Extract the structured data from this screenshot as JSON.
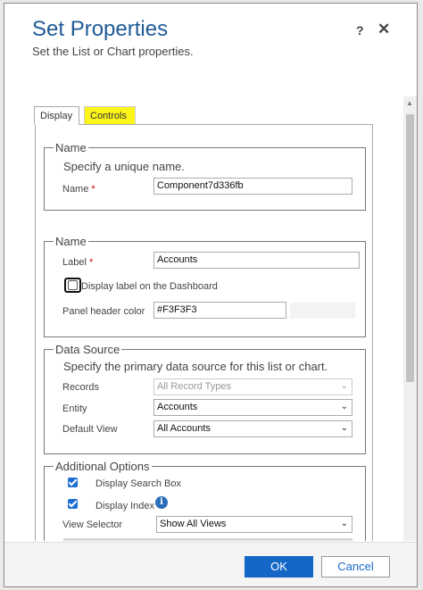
{
  "dialog": {
    "title": "Set Properties",
    "subtitle": "Set the List or Chart properties.",
    "help_icon": "?",
    "close_icon": "✕"
  },
  "tabs": [
    {
      "label": "Display",
      "selected": true
    },
    {
      "label": "Controls",
      "highlight": "#fdf51a"
    }
  ],
  "name_section": {
    "legend": "Name",
    "description": "Specify a unique name.",
    "name_label": "Name",
    "required_mark": "*",
    "name_value": "Component7d336fb"
  },
  "label_section": {
    "legend": "Name",
    "label_label": "Label",
    "required_mark": "*",
    "label_value": "Accounts",
    "display_label_checkbox": "Display label on the Dashboard",
    "display_label_checked": false,
    "panel_header_color_label": "Panel header color",
    "panel_header_color_value": "#F3F3F3"
  },
  "data_source": {
    "legend": "Data Source",
    "description": "Specify the primary data source for this list or chart.",
    "records_label": "Records",
    "records_value": "All Record Types",
    "entity_label": "Entity",
    "entity_value": "Accounts",
    "default_view_label": "Default View",
    "default_view_value": "All Accounts"
  },
  "additional_options": {
    "legend": "Additional Options",
    "display_search_box": "Display Search Box",
    "display_search_box_checked": true,
    "display_index": "Display Index",
    "display_index_checked": true,
    "info_icon": "i",
    "view_selector_label": "View Selector",
    "view_selector_value": "Show All Views"
  },
  "footer": {
    "ok_label": "OK",
    "cancel_label": "Cancel"
  },
  "colors": {
    "title": "#1f5b97",
    "primary_button": "#1567c7",
    "checkbox": "#1f6ed4",
    "required": "#cc0000"
  }
}
